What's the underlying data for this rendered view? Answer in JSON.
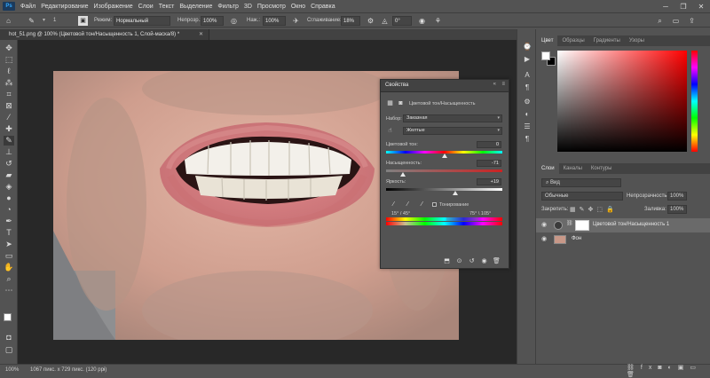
{
  "menu": {
    "app_icon": "Ps",
    "items": [
      "Файл",
      "Редактирование",
      "Изображение",
      "Слои",
      "Текст",
      "Выделение",
      "Фильтр",
      "3D",
      "Просмотр",
      "Окно",
      "Справка"
    ]
  },
  "options": {
    "mode_label": "Режим:",
    "mode_value": "Нормальный",
    "opacity_label": "Непрозр.:",
    "opacity_value": "100%",
    "pressure_label": "Наж.:",
    "pressure_value": "100%",
    "smoothing_label": "Сглаживание:",
    "smoothing_value": "18%",
    "angle_value": "0°",
    "brush_size": "1"
  },
  "document": {
    "tab_title": "hot_51.png @ 100% (Цветовой тон/Насыщенность 1, Слой-маска/8) *"
  },
  "properties": {
    "title": "Свойства",
    "layer_type": "Цветовой тон/Насыщенность",
    "preset_label": "Набор:",
    "preset_value": "Заказная",
    "channel_value": "Желтые",
    "hue_label": "Цветовой тон:",
    "hue_value": "0",
    "saturation_label": "Насыщенность:",
    "saturation_value": "-71",
    "lightness_label": "Яркость:",
    "lightness_value": "+19",
    "colorize_label": "Тонирование",
    "range_left": "15° / 45°",
    "range_right": "75° \\ 105°",
    "hue_fraction": 0.5,
    "saturation_fraction": 0.145,
    "lightness_fraction": 0.595
  },
  "color_panel": {
    "tabs": [
      "Цвет",
      "Образцы",
      "Градиенты",
      "Узоры"
    ]
  },
  "layers_panel": {
    "tabs": [
      "Слои",
      "Каналы",
      "Контуры"
    ],
    "filter_label": "Вид",
    "blend_mode": "Обычные",
    "opacity_label": "Непрозрачность:",
    "opacity_value": "100%",
    "lock_label": "Закрепить:",
    "fill_label": "Заливка:",
    "fill_value": "100%",
    "layers": [
      {
        "name": "Цветовой тон/Насыщенность 1"
      },
      {
        "name": "Фон"
      }
    ]
  },
  "status": {
    "zoom": "100%",
    "doc_info": "1067 пикс. x 729 пикс. (120 ppi)"
  },
  "colors": {
    "ui_bg": "#535353",
    "canvas_bg": "#282828",
    "panel_dark": "#424242",
    "accent": "#31a8ff"
  }
}
